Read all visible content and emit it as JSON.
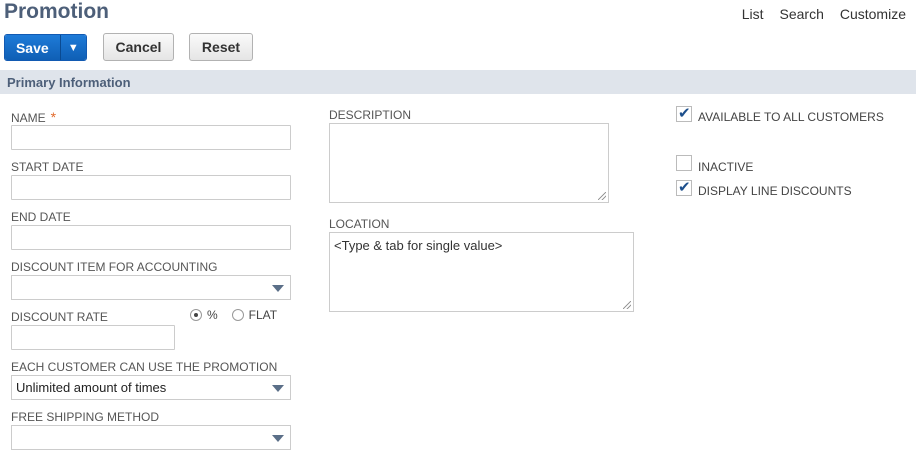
{
  "page": {
    "title": "Promotion"
  },
  "top_links": [
    "List",
    "Search",
    "Customize"
  ],
  "toolbar": {
    "save_label": "Save",
    "save_menu_icon": "caret-down-icon",
    "cancel_label": "Cancel",
    "reset_label": "Reset"
  },
  "section": {
    "title": "Primary Information"
  },
  "form": {
    "name": {
      "label": "NAME",
      "required_mark": "*",
      "value": ""
    },
    "start_date": {
      "label": "START DATE",
      "value": ""
    },
    "end_date": {
      "label": "END DATE",
      "value": ""
    },
    "discount_item": {
      "label": "DISCOUNT ITEM FOR ACCOUNTING",
      "value": ""
    },
    "discount_rate": {
      "label": "DISCOUNT RATE",
      "value": "",
      "options": [
        {
          "label": "%",
          "selected": true
        },
        {
          "label": "FLAT",
          "selected": false
        }
      ]
    },
    "each_customer": {
      "label": "EACH CUSTOMER CAN USE THE PROMOTION",
      "value": "Unlimited amount of times"
    },
    "free_shipping": {
      "label": "FREE SHIPPING METHOD",
      "value": ""
    },
    "description": {
      "label": "DESCRIPTION",
      "value": ""
    },
    "location": {
      "label": "LOCATION",
      "placeholder": "<Type & tab for single value>"
    },
    "available_all": {
      "label": "AVAILABLE TO ALL CUSTOMERS",
      "checked": true
    },
    "inactive": {
      "label": "INACTIVE",
      "checked": false
    },
    "display_line_discounts": {
      "label": "DISPLAY LINE DISCOUNTS",
      "checked": true
    }
  },
  "colors": {
    "title": "#4d5f79",
    "save_button": "#1565c0",
    "section_bar": "#dfe4eb",
    "required": "#e26a2c"
  }
}
